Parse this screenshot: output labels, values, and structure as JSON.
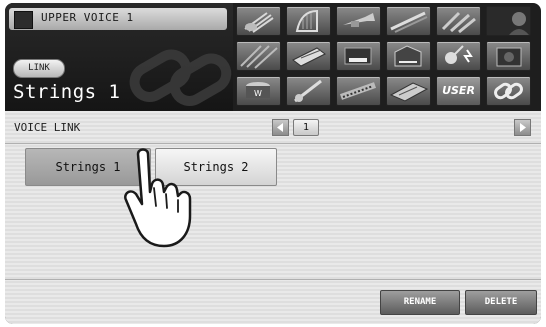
{
  "header": {
    "part_title": "UPPER VOICE 1",
    "link_badge": "LINK",
    "voice_name": "Strings 1"
  },
  "voice_grid": {
    "rows": [
      [
        "strings-icon",
        "harp-icon",
        "trumpet-icon",
        "flute-icon",
        "brass-section-icon",
        "vocal-icon"
      ],
      [
        "pad-icon",
        "keyboard-icon",
        "piano-icon",
        "organ-icon",
        "guitar-icon",
        "amp-icon"
      ],
      [
        "percussion-icon",
        "bass-guitar-icon",
        "synth-icon",
        "mixer-icon",
        "USER",
        "link-icon"
      ]
    ],
    "user_label": "USER"
  },
  "voice_link": {
    "label": "VOICE LINK",
    "page": "1",
    "buttons": [
      "Strings 1",
      "Strings 2"
    ],
    "selected_index": 0
  },
  "actions": {
    "rename": "RENAME",
    "delete": "DELETE"
  },
  "colors": {
    "screen_bg": "#1e1e1e",
    "panel_bg": "#e9e9e9",
    "selected_button": "#a8a8a8"
  }
}
